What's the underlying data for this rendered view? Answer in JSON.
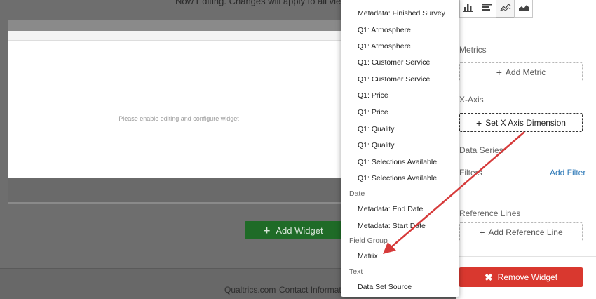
{
  "editor": {
    "banner": "Now Editing. Changes will apply to all viewers.",
    "widget_message": "Please enable editing and configure widget",
    "add_widget_label": "Add Widget"
  },
  "footer": {
    "links": [
      "Qualtrics.com",
      "Contact Information"
    ]
  },
  "dropdown": {
    "items": [
      {
        "kind": "item",
        "label": "Metadata: Finished Survey"
      },
      {
        "kind": "item",
        "label": "Q1: Atmosphere"
      },
      {
        "kind": "item",
        "label": "Q1: Atmosphere"
      },
      {
        "kind": "item",
        "label": "Q1: Customer Service"
      },
      {
        "kind": "item",
        "label": "Q1: Customer Service"
      },
      {
        "kind": "item",
        "label": "Q1: Price"
      },
      {
        "kind": "item",
        "label": "Q1: Price"
      },
      {
        "kind": "item",
        "label": "Q1: Quality"
      },
      {
        "kind": "item",
        "label": "Q1: Quality"
      },
      {
        "kind": "item",
        "label": "Q1: Selections Available"
      },
      {
        "kind": "item",
        "label": "Q1: Selections Available"
      },
      {
        "kind": "group",
        "label": "Date"
      },
      {
        "kind": "item",
        "label": "Metadata: End Date"
      },
      {
        "kind": "item",
        "label": "Metadata: Start Date"
      },
      {
        "kind": "group",
        "label": "Field Group"
      },
      {
        "kind": "item",
        "label": "Matrix"
      },
      {
        "kind": "group",
        "label": "Text"
      },
      {
        "kind": "item",
        "label": "Data Set Source"
      }
    ]
  },
  "panel": {
    "chart_types": [
      "bar-chart-icon",
      "horizontal-bar-chart-icon",
      "line-chart-icon",
      "area-chart-icon"
    ],
    "metrics_label": "Metrics",
    "add_metric": "Add Metric",
    "xaxis_label": "X-Axis",
    "set_xaxis": "Set X Axis Dimension",
    "data_series_label": "Data Series",
    "filters_label": "Filters",
    "add_filter": "Add Filter",
    "reference_lines_label": "Reference Lines",
    "add_reference_line": "Add Reference Line",
    "remove_widget": "Remove Widget"
  },
  "colors": {
    "add_widget_green": "#1f6b27",
    "remove_red": "#d9382f",
    "link_blue": "#2f7ab8",
    "annotation_arrow": "#d63a3a"
  }
}
